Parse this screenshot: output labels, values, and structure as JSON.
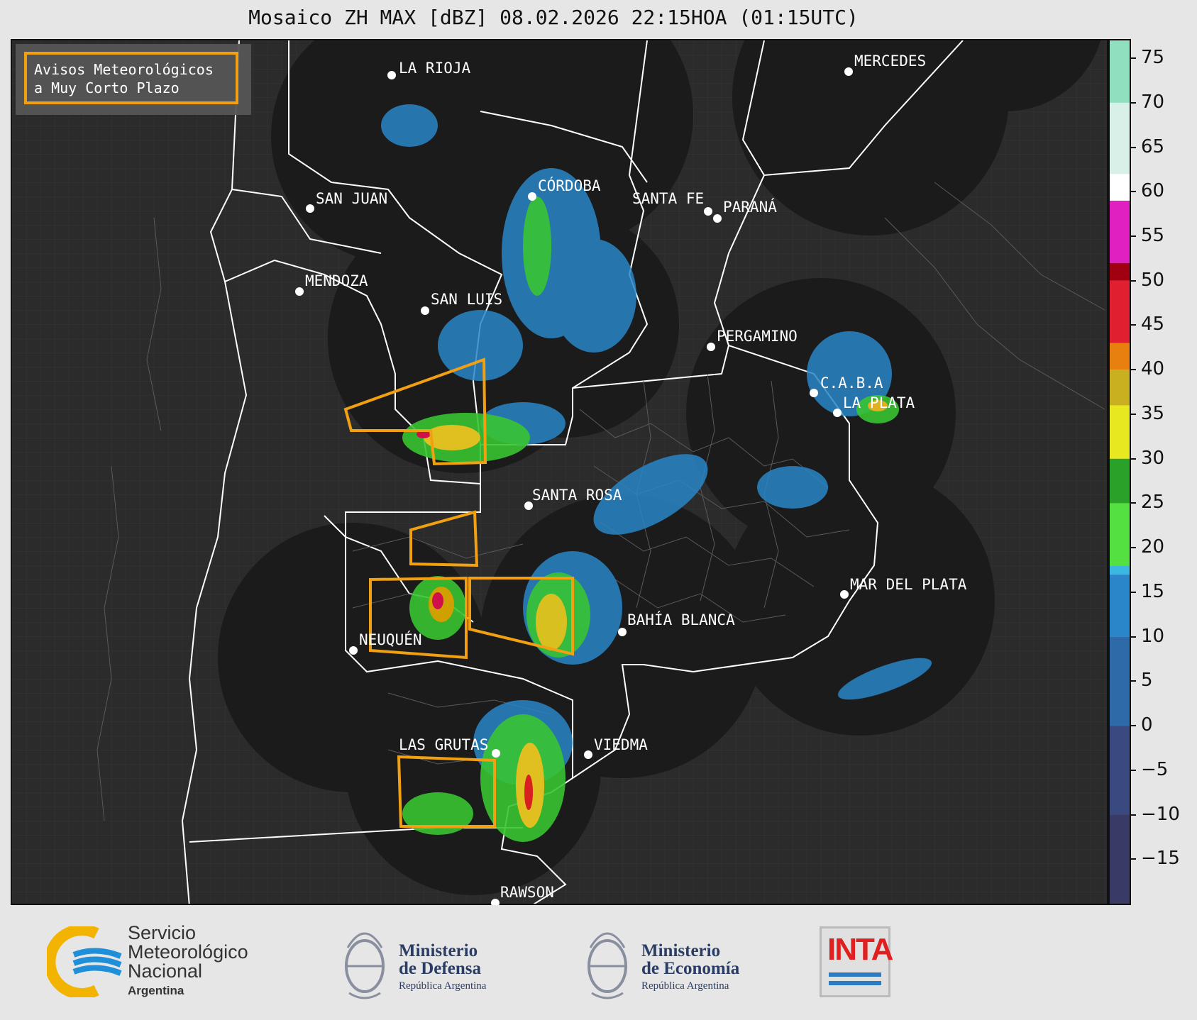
{
  "header": {
    "title": "Mosaico ZH MAX [dBZ] 08.02.2026 22:15HOA (01:15UTC)"
  },
  "legend": {
    "line1": "Avisos Meteorológicos",
    "line2": "a Muy Corto Plazo",
    "border_color": "#f0a010"
  },
  "cities": [
    {
      "name": "LA RIOJA"
    },
    {
      "name": "SAN JUAN"
    },
    {
      "name": "CÓRDOBA"
    },
    {
      "name": "SANTA FE"
    },
    {
      "name": "PARANÁ"
    },
    {
      "name": "MENDOZA"
    },
    {
      "name": "SAN LUIS"
    },
    {
      "name": "PERGAMINO"
    },
    {
      "name": "C.A.B.A"
    },
    {
      "name": "LA PLATA"
    },
    {
      "name": "MERCEDES"
    },
    {
      "name": "SANTA ROSA"
    },
    {
      "name": "MAR DEL PLATA"
    },
    {
      "name": "NEUQUÉN"
    },
    {
      "name": "BAHÍA BLANCA"
    },
    {
      "name": "LAS GRUTAS"
    },
    {
      "name": "VIEDMA"
    },
    {
      "name": "RAWSON"
    }
  ],
  "colorbar": {
    "unit": "dBZ",
    "range": [
      -20,
      77
    ],
    "ticks": [
      "75",
      "70",
      "65",
      "60",
      "55",
      "50",
      "45",
      "40",
      "35",
      "30",
      "25",
      "20",
      "15",
      "10",
      "5",
      "0",
      "−5",
      "−10",
      "−15"
    ],
    "tick_values": [
      75,
      70,
      65,
      60,
      55,
      50,
      45,
      40,
      35,
      30,
      25,
      20,
      15,
      10,
      5,
      0,
      -5,
      -10,
      -15
    ]
  },
  "footer": {
    "smn_line1": "Servicio",
    "smn_line2": "Meteorológico",
    "smn_line3": "Nacional",
    "smn_line4": "Argentina",
    "defensa_line1": "Ministerio",
    "defensa_line2": "de Defensa",
    "defensa_line3": "República Argentina",
    "economia_line1": "Ministerio",
    "economia_line2": "de Economía",
    "economia_line3": "República Argentina",
    "inta": "INTA"
  }
}
